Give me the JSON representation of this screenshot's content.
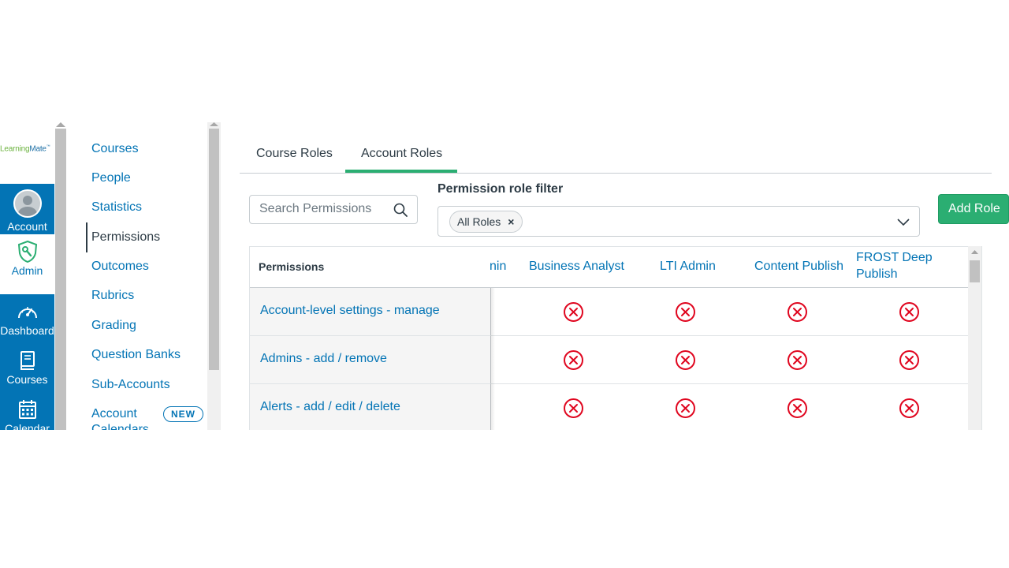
{
  "logo": {
    "part1": "Learning",
    "part2": "Mate",
    "mark": "™"
  },
  "global_nav": {
    "account": "Account",
    "admin": "Admin",
    "dashboard": "Dashboard",
    "courses": "Courses",
    "calendar": "Calendar"
  },
  "section_nav": {
    "items": [
      "Courses",
      "People",
      "Statistics",
      "Permissions",
      "Outcomes",
      "Rubrics",
      "Grading",
      "Question Banks",
      "Sub-Accounts",
      "Account Calendars"
    ],
    "active": "Permissions",
    "new_badge": "NEW"
  },
  "tabs": {
    "course_roles": "Course Roles",
    "account_roles": "Account Roles",
    "selected": "Account Roles"
  },
  "search": {
    "placeholder": "Search Permissions",
    "value": ""
  },
  "filter": {
    "label": "Permission role filter",
    "chip": "All Roles",
    "chip_remove": "×"
  },
  "add_role": "Add Role",
  "table": {
    "header": "Permissions",
    "roles": [
      "nin",
      "Business Analyst",
      "LTI Admin",
      "Content Publish",
      "FROST Deep Publish"
    ],
    "rows": [
      {
        "permission": "Account-level settings - manage",
        "states": [
          "disabled",
          "disabled",
          "disabled",
          "disabled"
        ]
      },
      {
        "permission": "Admins - add / remove",
        "states": [
          "disabled",
          "disabled",
          "disabled",
          "disabled"
        ]
      },
      {
        "permission": "Alerts - add / edit / delete",
        "states": [
          "disabled",
          "disabled",
          "disabled",
          "disabled"
        ]
      }
    ]
  },
  "colors": {
    "nav_blue": "#0374b5",
    "link_blue": "#0374b5",
    "accent_green": "#2bae72",
    "disabled_red": "#e0061f",
    "text_dark": "#2d3b45"
  },
  "icons": {
    "search": "search-icon",
    "chevron": "chevron-down-icon",
    "state": "x-circle-icon",
    "admin": "shield-wrench-icon",
    "dashboard": "speedometer-icon",
    "courses": "book-icon",
    "calendar": "calendar-icon"
  }
}
